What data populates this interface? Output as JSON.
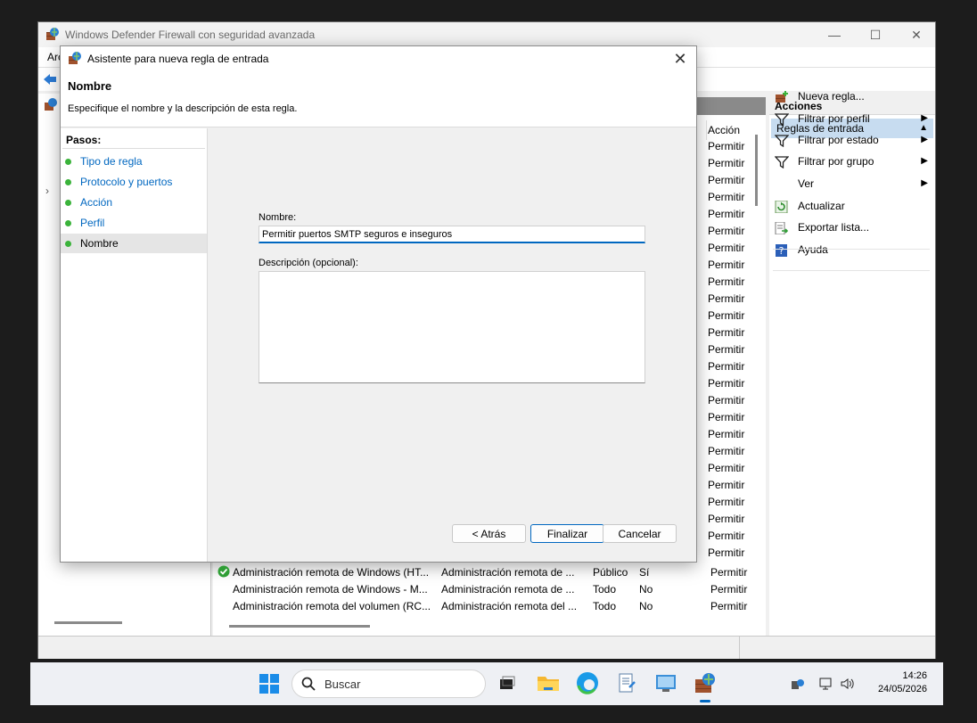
{
  "main_window": {
    "title": "Windows Defender Firewall con seguridad avanzada",
    "menu_partial": "Arc",
    "minimize": "—",
    "maximize": "☐",
    "close": "✕"
  },
  "list": {
    "column_action": "Acción",
    "permit_label": "Permitir",
    "rows": [
      {
        "name": "Administración remota de Windows (HT...",
        "group": "Administración remota de ...",
        "profile": "Público",
        "enabled": "Sí",
        "action": "Permitir",
        "enabled_icon": true
      },
      {
        "name": "Administración remota de Windows - M...",
        "group": "Administración remota de ...",
        "profile": "Todo",
        "enabled": "No",
        "action": "Permitir",
        "enabled_icon": false
      },
      {
        "name": "Administración remota del volumen (RC...",
        "group": "Administración remota del ...",
        "profile": "Todo",
        "enabled": "No",
        "action": "Permitir",
        "enabled_icon": false
      }
    ]
  },
  "actions": {
    "title": "Acciones",
    "section": "Reglas de entrada",
    "items": [
      {
        "label": "Nueva regla...",
        "icon": "new-rule-icon",
        "arrow": false
      },
      {
        "label": "Filtrar por perfil",
        "icon": "filter-icon",
        "arrow": true
      },
      {
        "label": "Filtrar por estado",
        "icon": "filter-icon",
        "arrow": true
      },
      {
        "label": "Filtrar por grupo",
        "icon": "filter-icon",
        "arrow": true
      },
      {
        "label": "Ver",
        "icon": "none",
        "arrow": true
      },
      {
        "label": "Actualizar",
        "icon": "refresh-icon",
        "arrow": false
      },
      {
        "label": "Exportar lista...",
        "icon": "export-icon",
        "arrow": false
      },
      {
        "label": "Ayuda",
        "icon": "help-icon",
        "arrow": false
      }
    ]
  },
  "dialog": {
    "title": "Asistente para nueva regla de entrada",
    "header": "Nombre",
    "subheader": "Especifique el nombre y la descripción de esta regla.",
    "steps_title": "Pasos:",
    "steps": [
      {
        "label": "Tipo de regla",
        "active": false
      },
      {
        "label": "Protocolo y puertos",
        "active": false
      },
      {
        "label": "Acción",
        "active": false
      },
      {
        "label": "Perfil",
        "active": false
      },
      {
        "label": "Nombre",
        "active": true
      }
    ],
    "name_label": "Nombre:",
    "name_value": "Permitir puertos SMTP seguros e inseguros",
    "description_label": "Descripción (opcional):",
    "description_value": "",
    "back_button": "< Atrás",
    "finish_button": "Finalizar",
    "cancel_button": "Cancelar"
  },
  "taskbar": {
    "search_placeholder": "Buscar",
    "time": "14:26",
    "date": "24/05/2026"
  },
  "colors": {
    "accent": "#0067c0",
    "step_dot": "#3bb33b",
    "actions_section_bg": "#c7dcf0"
  }
}
